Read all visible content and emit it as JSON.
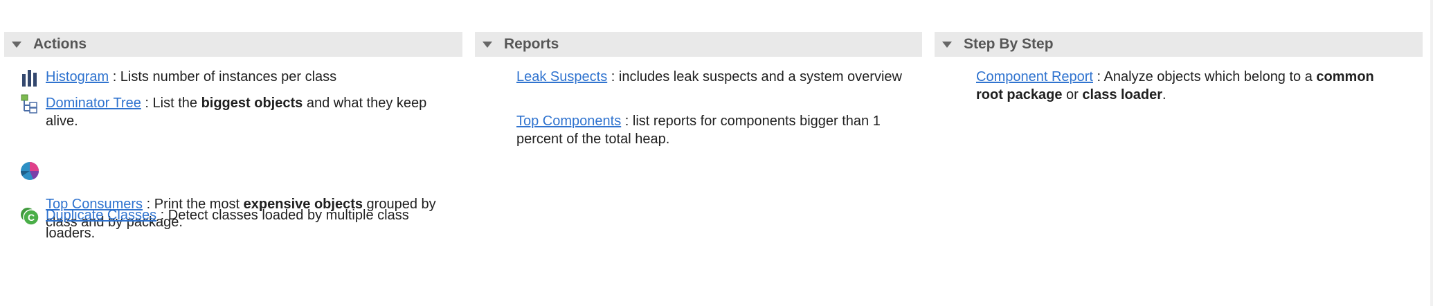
{
  "sections": [
    {
      "title": "Actions",
      "items": [
        {
          "link": "Histogram",
          "text": " : Lists number of instances per class",
          "icon": "histogram-icon"
        },
        {
          "link": "Dominator Tree",
          "text_before": " : List the ",
          "strong": "biggest objects",
          "text_after": " and what they keep alive.",
          "icon": "dominator-tree-icon"
        },
        {
          "link": "Top Consumers",
          "text_before": " : Print the most ",
          "strong": "expensive objects",
          "text_after": " grouped by class and by package.",
          "icon": "top-consumers-icon"
        },
        {
          "link": "Duplicate Classes",
          "text": " : Detect classes loaded by multiple class loaders.",
          "icon": "duplicate-classes-icon",
          "icon_glyph": "C"
        }
      ]
    },
    {
      "title": "Reports",
      "items": [
        {
          "link": "Leak Suspects",
          "text": " : includes leak suspects and a system overview"
        },
        {
          "link": "Top Components",
          "text": " : list reports for components bigger than 1 percent of the total heap."
        }
      ]
    },
    {
      "title": "Step By Step",
      "items": [
        {
          "link": "Component Report",
          "text_before": " : Analyze objects which belong to a ",
          "strong": "common root package",
          "text_middle": " or ",
          "strong2": "class loader",
          "text_after": "."
        }
      ]
    }
  ],
  "colors": {
    "link": "#2f73cf",
    "header_bg": "#e9e9e9",
    "header_text": "#565656",
    "body_text": "#1f1f1f"
  }
}
